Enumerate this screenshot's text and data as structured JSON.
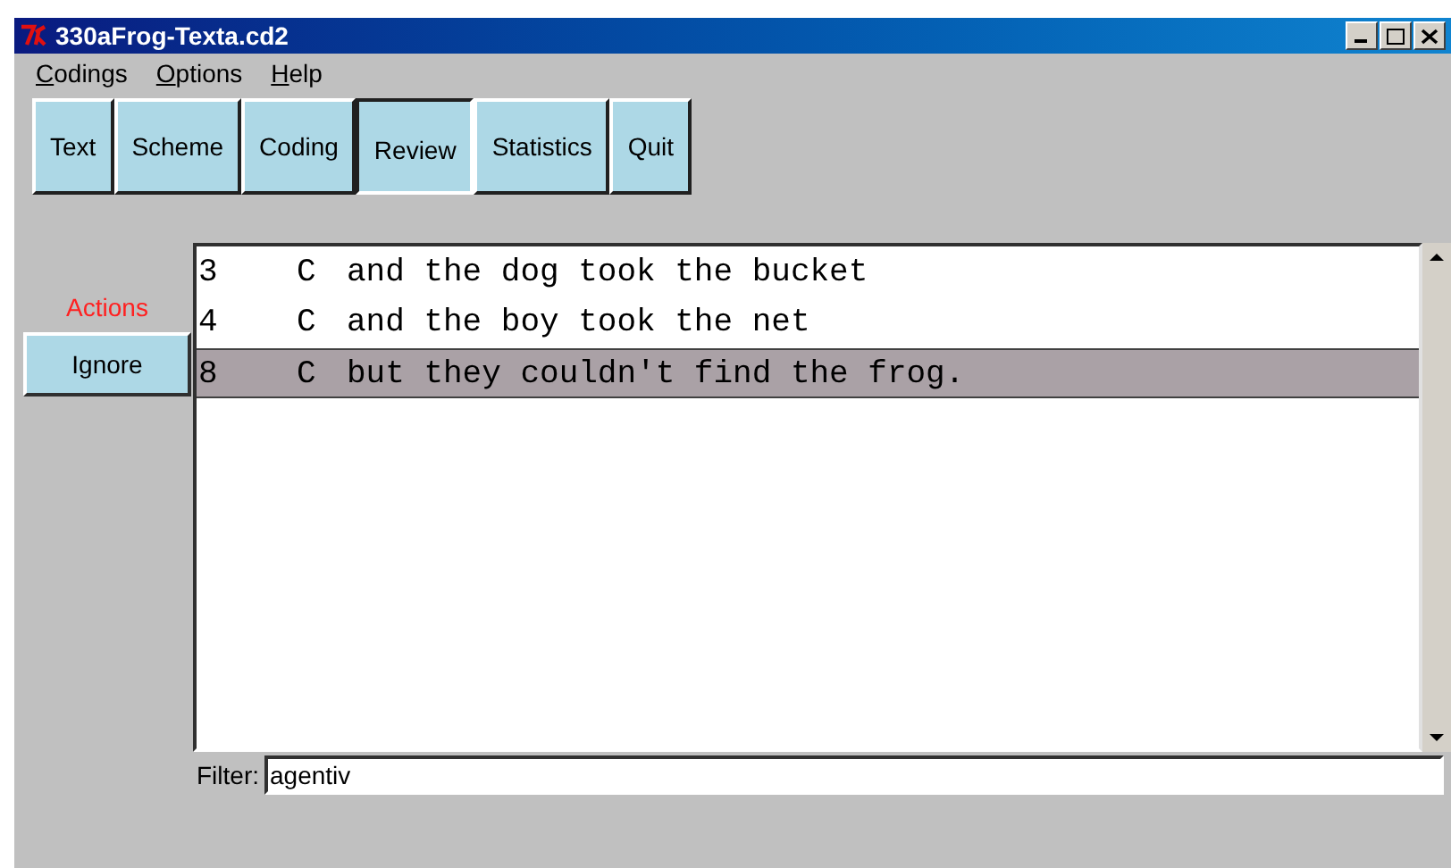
{
  "window": {
    "title": "330aFrog-Texta.cd2"
  },
  "menu": [
    "Codings",
    "Options",
    "Help"
  ],
  "tabs": [
    {
      "label": "Text",
      "selected": false
    },
    {
      "label": "Scheme",
      "selected": false
    },
    {
      "label": "Coding",
      "selected": false
    },
    {
      "label": "Review",
      "selected": true
    },
    {
      "label": "Statistics",
      "selected": false
    },
    {
      "label": "Quit",
      "selected": false
    }
  ],
  "actions": {
    "title": "Actions",
    "buttons": [
      "Ignore"
    ]
  },
  "list": [
    {
      "number": "3",
      "code": "C",
      "text": "and the dog took the bucket",
      "selected": false
    },
    {
      "number": "4",
      "code": "C",
      "text": "and the boy took the net",
      "selected": false
    },
    {
      "number": "8",
      "code": "C",
      "text": "but they couldn't find the frog.",
      "selected": true
    }
  ],
  "filter": {
    "label": "Filter:",
    "value": "agentiv"
  }
}
